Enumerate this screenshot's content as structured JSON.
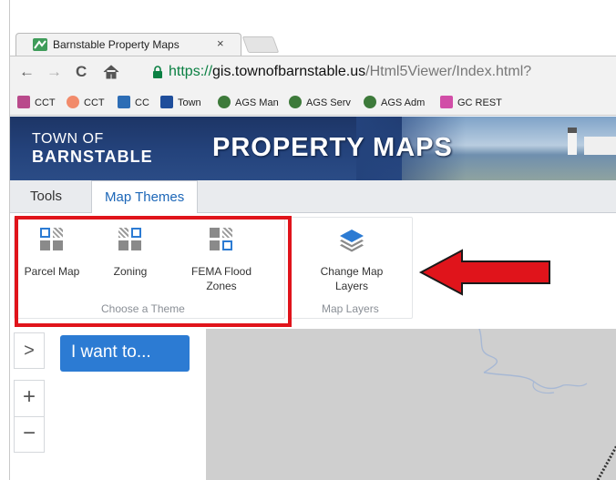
{
  "browser": {
    "tab_title": "Barnstable Property Maps",
    "tab_close": "×",
    "url_scheme": "https://",
    "url_host": "gis.townofbarnstable.us",
    "url_path": "/Html5Viewer/Index.html?",
    "nav": {
      "back": "←",
      "forward": "→",
      "reload": "C",
      "home": "🏠"
    }
  },
  "bookmarks": [
    {
      "label": "CCT",
      "color": "#b94a8b"
    },
    {
      "label": "CCT",
      "color": "#f28b6b"
    },
    {
      "label": "CC",
      "color": "#2d6db5"
    },
    {
      "label": "Town",
      "color": "#1f4e9b"
    },
    {
      "label": "AGS Man",
      "color": "#3d7a3a"
    },
    {
      "label": "AGS Serv",
      "color": "#3d7a3a"
    },
    {
      "label": "AGS Adm",
      "color": "#3d7a3a"
    },
    {
      "label": "GC REST",
      "color": "#d14ea7"
    }
  ],
  "banner": {
    "town_of": "TOWN OF",
    "town_name": "BARNSTABLE",
    "title": "PROPERTY MAPS"
  },
  "app_tabs": {
    "tools": "Tools",
    "map_themes": "Map Themes"
  },
  "ribbon": {
    "theme_group": {
      "caption": "Choose a Theme",
      "buttons": [
        {
          "label": "Parcel Map"
        },
        {
          "label": "Zoning"
        },
        {
          "label_line1": "FEMA Flood",
          "label_line2": "Zones"
        }
      ]
    },
    "layers_group": {
      "caption": "Map Layers",
      "button": {
        "label_line1": "Change Map",
        "label_line2": "Layers"
      }
    }
  },
  "map_panel": {
    "expander": ">",
    "i_want_to": "I want to...",
    "zoom_in": "+",
    "zoom_out": "−"
  },
  "colors": {
    "accent_blue": "#2c7bd3",
    "highlight_red": "#e0141b",
    "banner_navy": "#24437c"
  }
}
